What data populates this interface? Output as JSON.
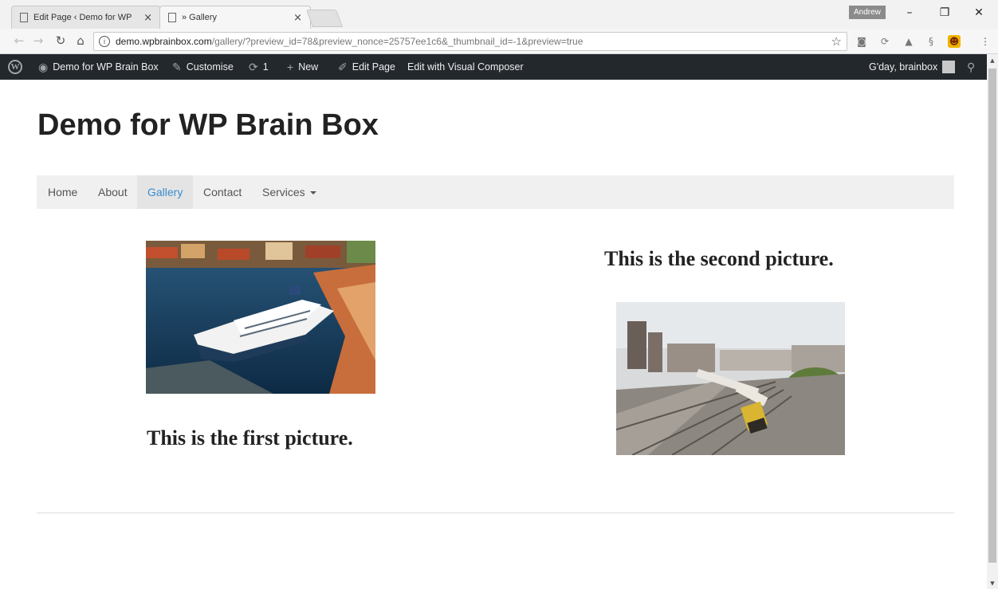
{
  "browser": {
    "tabs": [
      {
        "title": "Edit Page ‹ Demo for WP",
        "close": "×"
      },
      {
        "title": "» Gallery",
        "close": "×"
      }
    ],
    "profile_name": "Andrew",
    "window_controls": {
      "minimize": "–",
      "restore": "❐",
      "close": "✕"
    },
    "address": {
      "host": "demo.wpbrainbox.com",
      "path": "/gallery/?preview_id=78&preview_nonce=25757ee1c6&_thumbnail_id=-1&preview=true"
    }
  },
  "admin_bar": {
    "site_name": "Demo for WP Brain Box",
    "customise": "Customise",
    "updates_count": "1",
    "new": "New",
    "edit_page": "Edit Page",
    "visual_composer": "Edit with Visual Composer",
    "greeting": "G'day, brainbox"
  },
  "site": {
    "title": "Demo for WP Brain Box",
    "menu": [
      "Home",
      "About",
      "Gallery",
      "Contact",
      "Services"
    ],
    "active_menu": "Gallery"
  },
  "gallery": {
    "first_caption": "This is the first picture.",
    "second_caption": "This is the second picture."
  },
  "colors": {
    "admin_bar": "#23282d",
    "menu_active_text": "#3b8bd0",
    "menu_background": "#f0f0f0"
  }
}
